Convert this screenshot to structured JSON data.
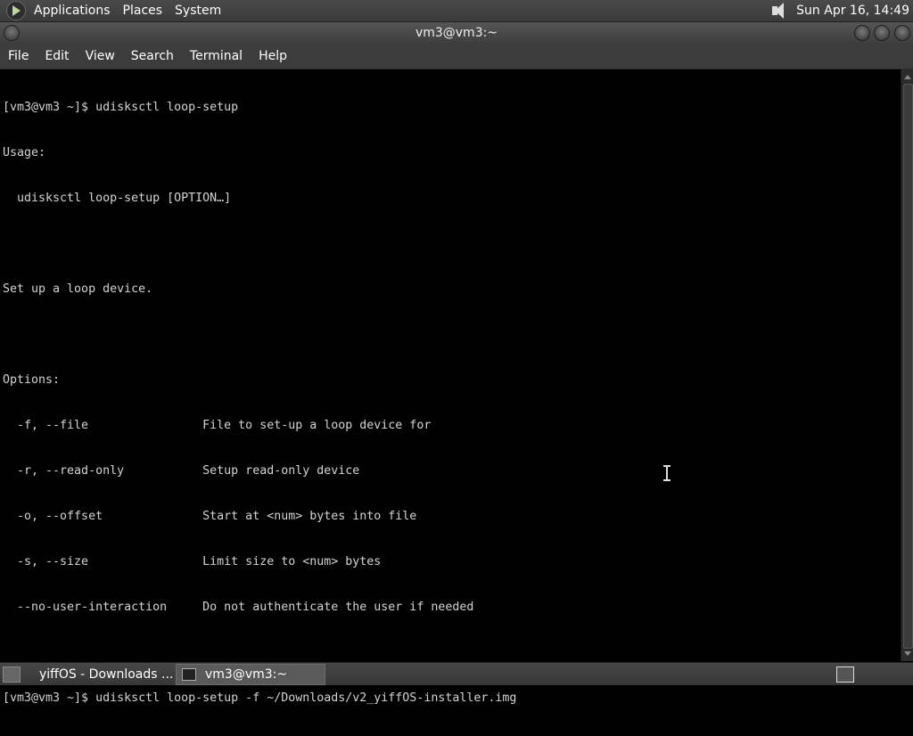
{
  "top_panel": {
    "menus": [
      "Applications",
      "Places",
      "System"
    ],
    "clock": "Sun Apr 16, 14:49"
  },
  "window": {
    "title": "vm3@vm3:~"
  },
  "menu_bar": {
    "items": [
      "File",
      "Edit",
      "View",
      "Search",
      "Terminal",
      "Help"
    ]
  },
  "terminal": {
    "lines": [
      "[vm3@vm3 ~]$ udisksctl loop-setup",
      "Usage:",
      "  udisksctl loop-setup [OPTION…]",
      "",
      "Set up a loop device.",
      "",
      "Options:",
      "  -f, --file                File to set-up a loop device for",
      "  -r, --read-only           Setup read-only device",
      "  -o, --offset              Start at <num> bytes into file",
      "  -s, --size                Limit size to <num> bytes",
      "  --no-user-interaction     Do not authenticate the user if needed",
      "",
      "[vm3@vm3 ~]$ udisksctl loop-setup -f ~/Downloads/v2_yiffOS-installer.img"
    ]
  },
  "taskbar": {
    "tasks": [
      "yiffOS - Downloads ...",
      "vm3@vm3:~"
    ]
  },
  "icons": {
    "panel_logo": "gnome-foot-icon",
    "volume": "speaker-icon",
    "firefox": "firefox-icon",
    "terminal": "terminal-icon"
  }
}
